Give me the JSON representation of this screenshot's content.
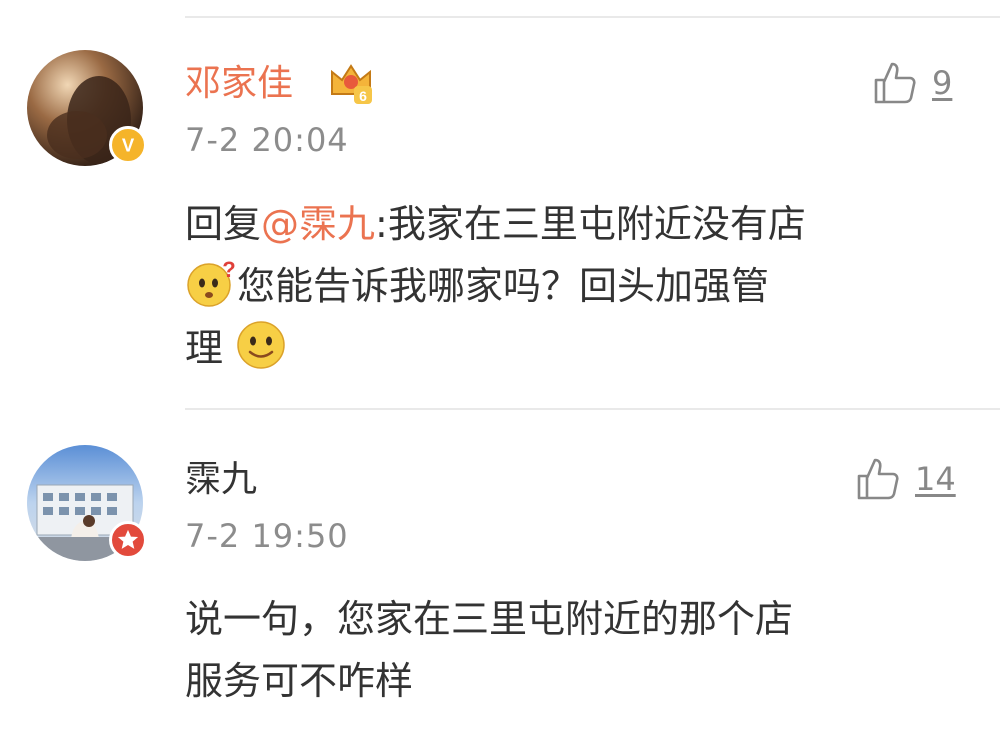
{
  "comments": [
    {
      "username": "邓家佳",
      "username_color": "#eb7350",
      "verified_badge": "vip-yellow-v-icon",
      "member_badge": "crown-level-6-icon",
      "member_level": "6",
      "timestamp": "7-2 20:04",
      "likes": "9",
      "reply_prefix": "回复",
      "mention": "@霂九",
      "text_part1": ":我家在三里屯附近没有店",
      "text_part2": "您能告诉我哪家吗？回头加强管",
      "text_part3": "理",
      "emoji_1": "thinking-face-icon",
      "emoji_2": "smile-face-icon"
    },
    {
      "username": "霂九",
      "username_color": "#333333",
      "verified_badge": "red-star-icon",
      "timestamp": "7-2 19:50",
      "likes": "14",
      "text_line1": "说一句，您家在三里屯附近的那个店",
      "text_line2": "服务可不咋样"
    }
  ],
  "colors": {
    "accent": "#eb7350",
    "timestamp": "#8c8c8c",
    "divider": "#e9e9e9"
  }
}
